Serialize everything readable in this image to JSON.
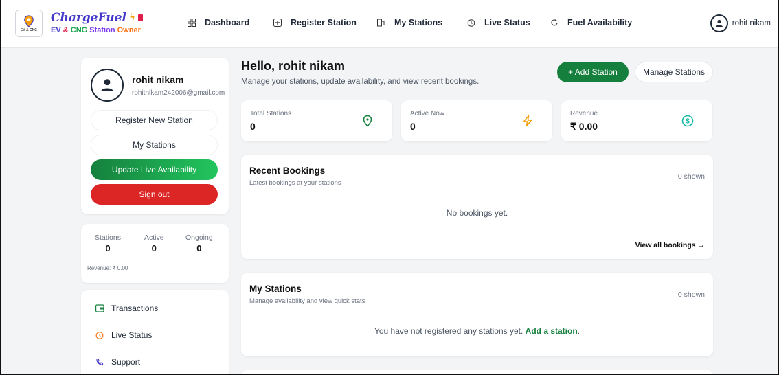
{
  "brand": {
    "logo_caption": "EV & CNG",
    "name": "ChargeFuel",
    "tag_ev": "EV",
    "tag_amp": "&",
    "tag_cng": "CNG",
    "tag_station": "Station",
    "tag_owner": "Owner"
  },
  "nav": {
    "items": [
      {
        "label": "Dashboard",
        "icon": "grid-icon"
      },
      {
        "label": "Register Station",
        "icon": "plus-square-icon"
      },
      {
        "label": "My Stations",
        "icon": "stations-icon"
      },
      {
        "label": "Live Status",
        "icon": "clock-icon"
      },
      {
        "label": "Fuel Availability",
        "icon": "refresh-icon"
      }
    ],
    "user_name": "rohit nikam"
  },
  "sidebar": {
    "profile": {
      "name": "rohit nikam",
      "email": "rohitnikam242006@gmail.com"
    },
    "buttons": {
      "register": "Register New Station",
      "my_stations": "My Stations",
      "update": "Update Live Availability",
      "signout": "Sign out"
    },
    "stats": {
      "stations_label": "Stations",
      "stations_value": "0",
      "active_label": "Active",
      "active_value": "0",
      "ongoing_label": "Ongoing",
      "ongoing_value": "0",
      "revenue": "Revenue: ₹ 0.00"
    },
    "links": [
      {
        "label": "Transactions",
        "icon": "wallet-icon"
      },
      {
        "label": "Live Status",
        "icon": "clock-icon"
      },
      {
        "label": "Support",
        "icon": "phone-icon"
      }
    ]
  },
  "main": {
    "greeting": "Hello, rohit nikam",
    "subtitle": "Manage your stations, update availability, and view recent bookings.",
    "add_station": "+ Add Station",
    "manage_stations": "Manage Stations",
    "stat_cards": [
      {
        "label": "Total Stations",
        "value": "0",
        "icon": "location-pin-icon",
        "color": "#15803d"
      },
      {
        "label": "Active Now",
        "value": "0",
        "icon": "bolt-icon",
        "color": "#f59e0b"
      },
      {
        "label": "Revenue",
        "value": "₹ 0.00",
        "icon": "dollar-coin-icon",
        "color": "#14b8a6"
      }
    ],
    "recent_bookings": {
      "title": "Recent Bookings",
      "subtitle": "Latest bookings at your stations",
      "count": "0 shown",
      "empty": "No bookings yet.",
      "view_all": "View all bookings →"
    },
    "my_stations": {
      "title": "My Stations",
      "subtitle": "Manage availability and view quick stats",
      "count": "0 shown",
      "empty_prefix": "You have not registered any stations yet.",
      "empty_link": "Add a station",
      "empty_suffix": "."
    }
  },
  "colors": {
    "primary_green": "#15803d",
    "danger_red": "#dc2626",
    "brand_indigo": "#4338ca"
  }
}
